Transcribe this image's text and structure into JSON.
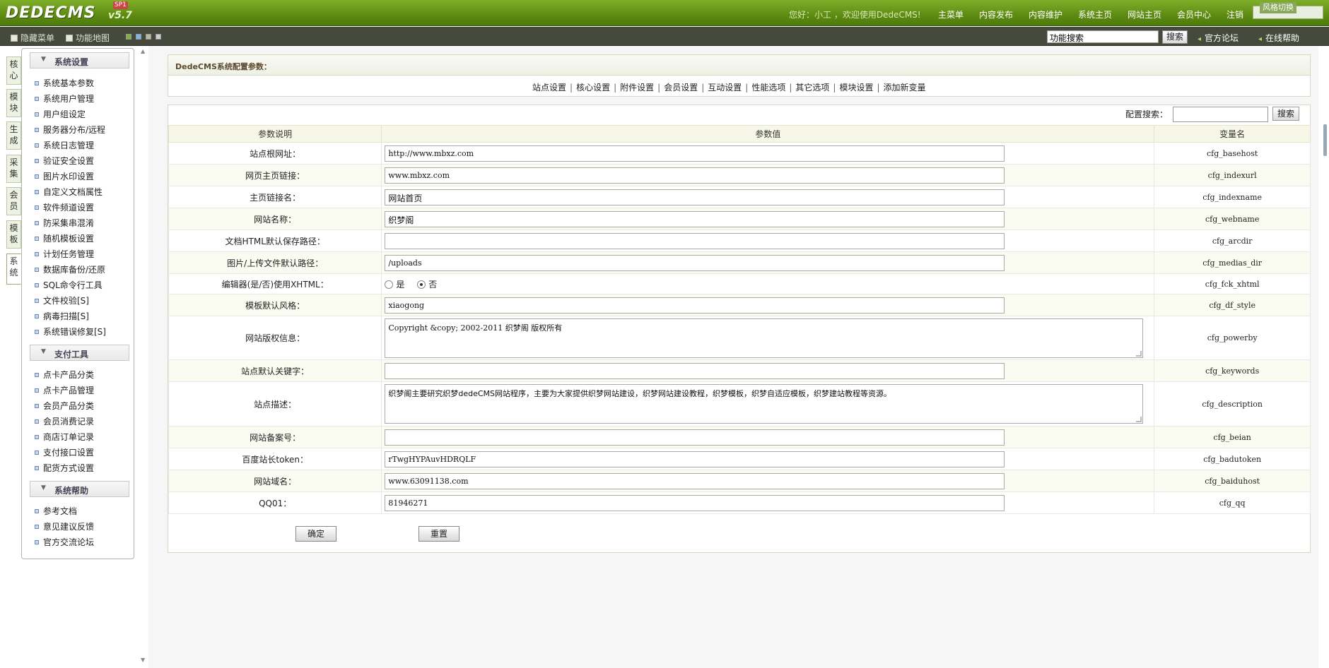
{
  "header": {
    "logo_text": "DEDECMS",
    "version": "v5.7",
    "edition": "SP1",
    "greeting": "您好：小工 ，欢迎使用DedeCMS!",
    "nav": [
      "主菜单",
      "内容发布",
      "内容维护",
      "系统主页",
      "网站主页",
      "会员中心",
      "注销"
    ],
    "sysbox_label": "风格切换"
  },
  "subbar": {
    "hide_menu": "隐藏菜单",
    "func_map": "功能地图",
    "swatch_colors": [
      "#7fb337",
      "#7ab6e8",
      "#b9b9a2",
      "#cfcfcf"
    ],
    "search_value": "功能搜索",
    "search_button": "搜索",
    "links": [
      "官方论坛",
      "在线帮助"
    ]
  },
  "vtabs": [
    "核心",
    "模块",
    "生成",
    "采集",
    "会员",
    "模板",
    "系统"
  ],
  "menu": {
    "sections": [
      {
        "title": "系统设置",
        "items": [
          "系统基本参数",
          "系统用户管理",
          "用户组设定",
          "服务器分布/远程",
          "系统日志管理",
          "验证安全设置",
          "图片水印设置",
          "自定义文档属性",
          "软件频道设置",
          "防采集串混淆",
          "随机模板设置",
          "计划任务管理",
          "数据库备份/还原",
          "SQL命令行工具",
          "文件校验[S]",
          "病毒扫描[S]",
          "系统错误修复[S]"
        ]
      },
      {
        "title": "支付工具",
        "items": [
          "点卡产品分类",
          "点卡产品管理",
          "会员产品分类",
          "会员消费记录",
          "商店订单记录",
          "支付接口设置",
          "配货方式设置"
        ]
      },
      {
        "title": "系统帮助",
        "items": [
          "参考文档",
          "意见建议反馈",
          "官方交流论坛"
        ]
      }
    ]
  },
  "main": {
    "title": "DedeCMS系统配置参数：",
    "tabs": [
      "站点设置",
      "核心设置",
      "附件设置",
      "会员设置",
      "互动设置",
      "性能选项",
      "其它选项",
      "模块设置",
      "添加新变量"
    ],
    "cfg_search_label": "配置搜索：",
    "cfg_search_button": "搜索",
    "columns": [
      "参数说明",
      "参数值",
      "变量名"
    ],
    "rows": [
      {
        "label": "站点根网址：",
        "value": "http://www.mbxz.com",
        "var": "cfg_basehost"
      },
      {
        "label": "网页主页链接：",
        "value": "www.mbxz.com",
        "var": "cfg_indexurl"
      },
      {
        "label": "主页链接名：",
        "value": "网站首页",
        "var": "cfg_indexname"
      },
      {
        "label": "网站名称：",
        "value": "织梦阁",
        "var": "cfg_webname"
      },
      {
        "label": "文档HTML默认保存路径：",
        "value": "",
        "var": "cfg_arcdir"
      },
      {
        "label": "图片/上传文件默认路径：",
        "value": "/uploads",
        "var": "cfg_medias_dir"
      },
      {
        "label": "编辑器(是/否)使用XHTML：",
        "radio_yes": "是",
        "radio_no": "否",
        "var": "cfg_fck_xhtml"
      },
      {
        "label": "模板默认风格：",
        "value": "xiaogong",
        "var": "cfg_df_style"
      },
      {
        "label": "网站版权信息：",
        "value": "Copyright &copy; 2002-2011 织梦阁 版权所有",
        "var": "cfg_powerby"
      },
      {
        "label": "站点默认关键字：",
        "value": "",
        "var": "cfg_keywords"
      },
      {
        "label": "站点描述：",
        "value": "织梦阁主要研究织梦dedeCMS网站程序，主要为大家提供织梦网站建设，织梦网站建设教程，织梦模板，织梦自适应模板，织梦建站教程等资源。",
        "var": "cfg_description"
      },
      {
        "label": "网站备案号：",
        "value": "",
        "var": "cfg_beian"
      },
      {
        "label": "百度站长token：",
        "value": "rTwgHYPAuvHDRQLF",
        "var": "cfg_badutoken"
      },
      {
        "label": "网站域名：",
        "value": "www.63091138.com",
        "var": "cfg_baiduhost"
      },
      {
        "label": "QQ01：",
        "value": "81946271",
        "var": "cfg_qq"
      }
    ],
    "ok_button": "确定",
    "reset_button": "重置"
  }
}
